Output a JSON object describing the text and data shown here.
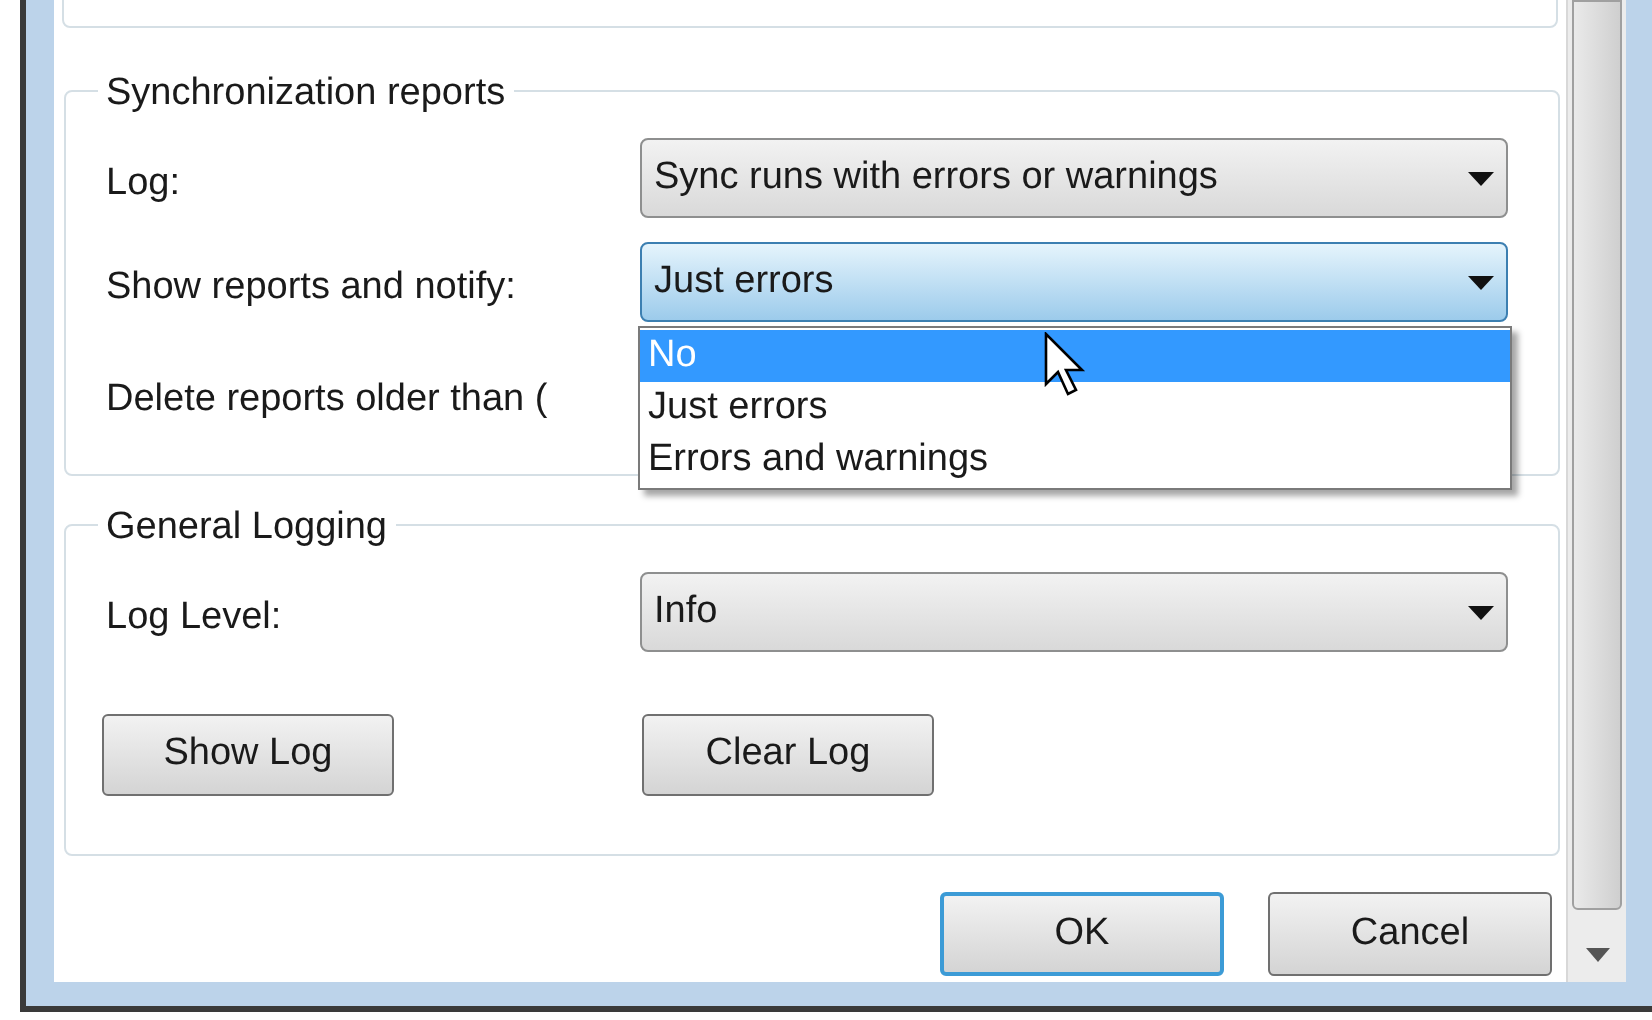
{
  "sync_reports": {
    "title": "Synchronization reports",
    "rows": [
      {
        "label": "Log:",
        "value": "Sync runs with errors or warnings",
        "focused": false
      },
      {
        "label": "Show reports and notify:",
        "value": "Just errors",
        "focused": true,
        "options": [
          {
            "label": "No",
            "highlighted": true
          },
          {
            "label": "Just errors",
            "highlighted": false
          },
          {
            "label": "Errors and warnings",
            "highlighted": false
          }
        ]
      },
      {
        "label": "Delete reports older than ("
      }
    ]
  },
  "general_logging": {
    "title": "General Logging",
    "rows": [
      {
        "label": "Log Level:",
        "value": "Info",
        "focused": false
      }
    ],
    "buttons": [
      "Show Log",
      "Clear Log"
    ]
  },
  "buttons": [
    {
      "label": "OK",
      "default": true
    },
    {
      "label": "Cancel",
      "default": false
    }
  ]
}
